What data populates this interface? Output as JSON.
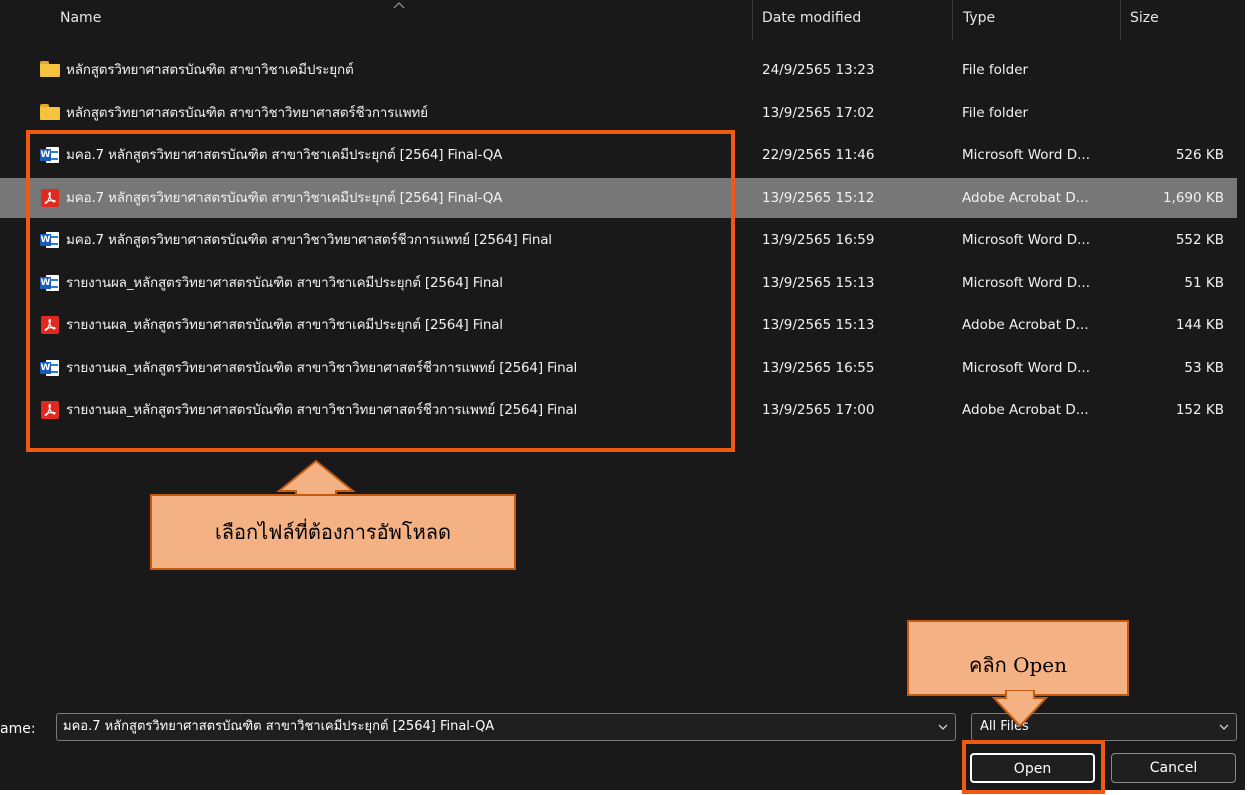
{
  "columns": {
    "name": "Name",
    "date": "Date modified",
    "type": "Type",
    "size": "Size"
  },
  "rows": [
    {
      "icon": "folder-icon",
      "name": "หลักสูตรวิทยาศาสตรบัณฑิต สาขาวิชาเคมีประยุกต์",
      "date": "24/9/2565 13:23",
      "type": "File folder",
      "size": ""
    },
    {
      "icon": "folder-icon",
      "name": "หลักสูตรวิทยาศาสตรบัณฑิต สาขาวิชาวิทยาศาสตร์ชีวการแพทย์",
      "date": "13/9/2565 17:02",
      "type": "File folder",
      "size": ""
    },
    {
      "icon": "word-icon",
      "name": "มคอ.7 หลักสูตรวิทยาศาสตรบัณฑิต สาขาวิชาเคมีประยุกต์ [2564] Final-QA",
      "date": "22/9/2565 11:46",
      "type": "Microsoft Word D...",
      "size": "526 KB"
    },
    {
      "icon": "pdf-icon",
      "name": "มคอ.7 หลักสูตรวิทยาศาสตรบัณฑิต สาขาวิชาเคมีประยุกต์ [2564] Final-QA",
      "date": "13/9/2565 15:12",
      "type": "Adobe Acrobat D...",
      "size": "1,690 KB",
      "selected": true
    },
    {
      "icon": "word-icon",
      "name": "มคอ.7 หลักสูตรวิทยาศาสตรบัณฑิต สาขาวิชาวิทยาศาสตร์ชีวการแพทย์  [2564] Final",
      "date": "13/9/2565 16:59",
      "type": "Microsoft Word D...",
      "size": "552 KB"
    },
    {
      "icon": "word-icon",
      "name": "รายงานผล_หลักสูตรวิทยาศาสตรบัณฑิต สาขาวิชาเคมีประยุกต์  [2564] Final",
      "date": "13/9/2565 15:13",
      "type": "Microsoft Word D...",
      "size": "51 KB"
    },
    {
      "icon": "pdf-icon",
      "name": "รายงานผล_หลักสูตรวิทยาศาสตรบัณฑิต สาขาวิชาเคมีประยุกต์  [2564] Final",
      "date": "13/9/2565 15:13",
      "type": "Adobe Acrobat D...",
      "size": "144 KB"
    },
    {
      "icon": "word-icon",
      "name": "รายงานผล_หลักสูตรวิทยาศาสตรบัณฑิต สาขาวิชาวิทยาศาสตร์ชีวการแพทย์  [2564] Final",
      "date": "13/9/2565 16:55",
      "type": "Microsoft Word D...",
      "size": "53 KB"
    },
    {
      "icon": "pdf-icon",
      "name": "รายงานผล_หลักสูตรวิทยาศาสตรบัณฑิต สาขาวิชาวิทยาศาสตร์ชีวการแพทย์  [2564] Final",
      "date": "13/9/2565 17:00",
      "type": "Adobe Acrobat D...",
      "size": "152 KB"
    }
  ],
  "annotations": {
    "select_files": "เลือกไฟล์ที่ต้องการอัพโหลด",
    "click_open": "คลิก Open",
    "highlight_color": "#ee5a12",
    "callout_color": "#f4b183"
  },
  "bottom": {
    "name_label": "ame:",
    "file_name_value": "มคอ.7 หลักสูตรวิทยาศาสตรบัณฑิต สาขาวิชาเคมีประยุกต์ [2564] Final-QA",
    "file_type_value": "All Files",
    "open_label": "Open",
    "cancel_label": "Cancel"
  }
}
